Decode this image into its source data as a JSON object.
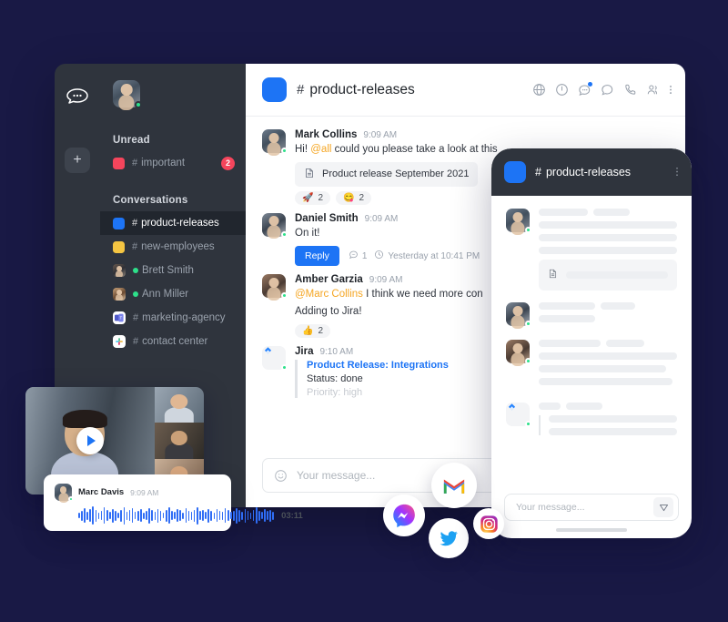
{
  "colors": {
    "page_background": "#191945",
    "sidebar": "#2f343d",
    "sidebar_active": "#21262e",
    "accent_blue": "#1d74f5",
    "badge_red": "#f5455c",
    "online_green": "#2de08a",
    "mention_orange": "#f5a623",
    "channel_important": "#f5455c",
    "channel_product_releases": "#1d74f5",
    "channel_new_employees": "#f5c542"
  },
  "app": {
    "logo_icon": "rocket-chat-icon",
    "add_button_label": "+",
    "user_avatar": {
      "name": "me-avatar",
      "status": "online"
    }
  },
  "sidebar": {
    "sections": [
      {
        "label": "Unread",
        "items": [
          {
            "icon": "square-red-icon",
            "hash": "#",
            "label": "important",
            "badge": "2",
            "type": "channel"
          }
        ]
      },
      {
        "label": "Conversations",
        "items": [
          {
            "icon": "square-blue-icon",
            "hash": "#",
            "label": "product-releases",
            "badge": "",
            "type": "channel",
            "active": true
          },
          {
            "icon": "square-yellow-icon",
            "hash": "#",
            "label": "new-employees",
            "badge": "",
            "type": "channel"
          },
          {
            "icon": "avatar-icon",
            "hash": "",
            "label": "Brett Smith",
            "badge": "",
            "type": "dm",
            "status": "online"
          },
          {
            "icon": "avatar-icon",
            "hash": "",
            "label": "Ann Miller",
            "badge": "",
            "type": "dm",
            "status": "online"
          },
          {
            "icon": "microsoft-teams-icon",
            "hash": "#",
            "label": "marketing-agency",
            "badge": "",
            "type": "channel"
          },
          {
            "icon": "slack-icon",
            "hash": "#",
            "label": "contact center",
            "badge": "",
            "type": "channel"
          }
        ]
      }
    ]
  },
  "chat": {
    "header": {
      "channel_name": "product-releases",
      "hash": "#",
      "icons": [
        "globe-icon",
        "info-circle-icon",
        "discussion-icon",
        "thread-icon",
        "phone-icon",
        "members-icon",
        "kebab-menu-icon"
      ]
    },
    "messages": [
      {
        "avatar": "mark-collins-avatar",
        "name": "Mark Collins",
        "time": "9:09 AM",
        "text_pre": "Hi! ",
        "mention": "@all",
        "text_post": " could you please take a look at this",
        "attachment": {
          "icon": "document-icon",
          "label": "Product release September 2021"
        },
        "reactions": [
          {
            "emoji": "🚀",
            "name": "rocket-reaction",
            "count": "2"
          },
          {
            "emoji": "😋",
            "name": "face-reaction",
            "count": "2"
          }
        ]
      },
      {
        "avatar": "daniel-smith-avatar",
        "name": "Daniel Smith",
        "time": "9:09 AM",
        "text_pre": "On it!",
        "mention": "",
        "text_post": "",
        "reply_button": "Reply",
        "reply_count_icon": "comment-icon",
        "reply_count": "1",
        "reply_clock_icon": "clock-icon",
        "reply_timestamp": "Yesterday at 10:41 PM"
      },
      {
        "avatar": "amber-garzia-avatar",
        "name": "Amber Garzia",
        "time": "9:09 AM",
        "mention": "@Marc Collins",
        "text_post": " I think we need more con",
        "text_line2": "Adding to Jira!",
        "reactions": [
          {
            "emoji": "👍",
            "name": "thumbs-up-reaction",
            "count": "2"
          }
        ]
      },
      {
        "avatar": "jira-bot-avatar",
        "name": "Jira",
        "time": "9:10 AM",
        "card": {
          "title": "Product Release: Integrations",
          "line1": "Status: done",
          "line2": "Priority: high"
        }
      }
    ],
    "composer": {
      "emoji_icon": "smiley-icon",
      "placeholder": "Your message..."
    }
  },
  "phone": {
    "header": {
      "channel_name": "product-releases",
      "hash": "#",
      "kebab": "kebab-menu-icon"
    },
    "skeleton_messages": [
      {
        "avatar": "mark-collins-avatar",
        "lines": 3,
        "has_attachment": true
      },
      {
        "avatar": "daniel-smith-avatar",
        "lines": 1,
        "has_attachment": false
      },
      {
        "avatar": "amber-garzia-avatar",
        "lines": 3,
        "has_attachment": false
      },
      {
        "avatar": "jira-bot-avatar",
        "lines": 2,
        "has_attachment": false,
        "is_card": true
      }
    ],
    "composer": {
      "placeholder": "Your message...",
      "send_icon": "send-icon"
    },
    "home_indicator": "home-indicator"
  },
  "video_call": {
    "play_button": "play-button",
    "main_participant": "participant-main",
    "side_participants": [
      "participant-2",
      "participant-3",
      "participant-4"
    ]
  },
  "audio_message": {
    "avatar": "marc-davis-avatar",
    "name": "Marc Davis",
    "time": "9:09 AM",
    "duration": "03:11",
    "waveform": [
      6,
      11,
      16,
      9,
      14,
      20,
      13,
      7,
      10,
      18,
      12,
      8,
      15,
      11,
      6,
      13,
      19,
      9,
      12,
      16,
      8,
      11,
      14,
      7,
      10,
      17,
      12,
      9,
      15,
      11,
      6,
      13,
      18,
      10,
      8,
      14,
      12,
      7,
      16,
      11,
      9,
      13,
      19,
      10,
      12,
      8,
      15,
      11,
      7,
      14,
      10,
      9,
      16,
      12,
      8,
      11,
      17,
      13,
      9,
      15,
      10,
      7,
      12,
      18,
      11,
      8,
      14,
      10,
      13,
      9
    ]
  },
  "floating_icons": [
    {
      "name": "gmail-icon",
      "label": "Gmail"
    },
    {
      "name": "messenger-icon",
      "label": "Messenger"
    },
    {
      "name": "twitter-icon",
      "label": "Twitter"
    },
    {
      "name": "instagram-icon",
      "label": "Instagram"
    }
  ]
}
